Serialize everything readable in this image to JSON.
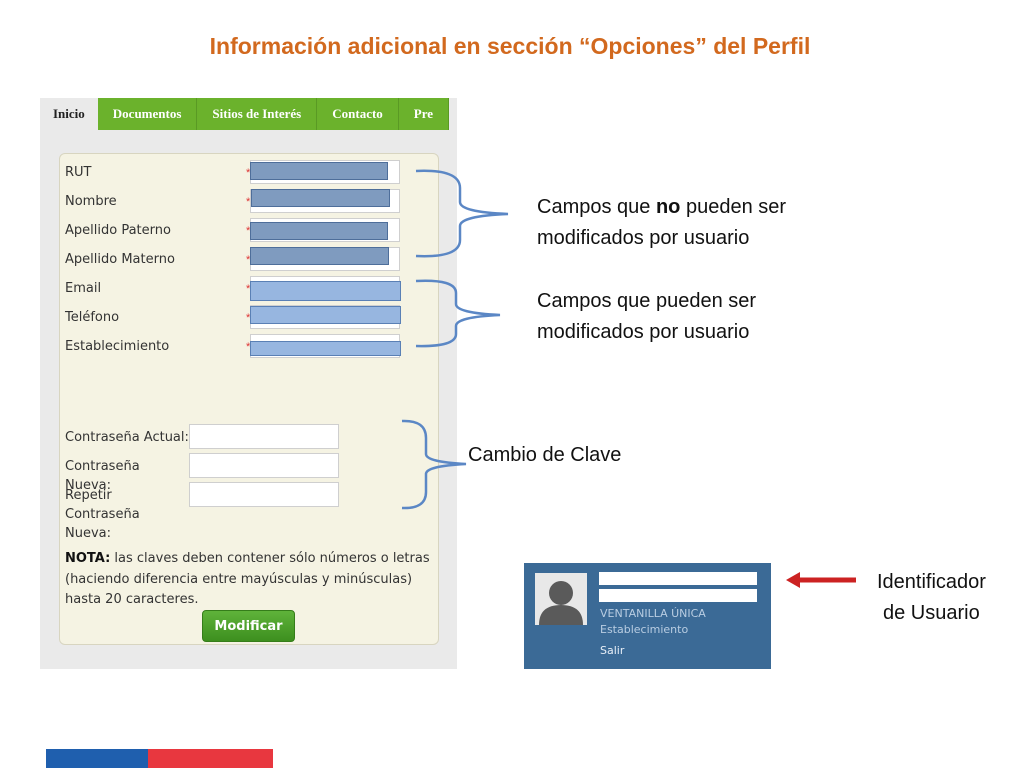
{
  "slide": {
    "title": "Información adicional en sección “Opciones” del Perfil"
  },
  "tabs": [
    "Inicio",
    "Documentos",
    "Sitios de Interés",
    "Contacto",
    "Pre"
  ],
  "profile_fields": [
    {
      "label": "RUT",
      "editable": false
    },
    {
      "label": "Nombre",
      "editable": false
    },
    {
      "label": "Apellido Paterno",
      "editable": false
    },
    {
      "label": "Apellido Materno",
      "editable": false
    },
    {
      "label": "Email",
      "editable": true
    },
    {
      "label": "Teléfono",
      "editable": true
    },
    {
      "label": "Establecimiento",
      "editable": true
    }
  ],
  "password": {
    "current_label": "Contraseña Actual:",
    "new_label": "Contraseña Nueva:",
    "repeat_label": "Repetir Contraseña Nueva:"
  },
  "note": {
    "prefix": "NOTA:",
    "text": " las claves deben contener sólo números o letras (haciendo diferencia entre mayúsculas y minúsculas) hasta 20 caracteres."
  },
  "submit_label": "Modificar",
  "annotations": {
    "non_editable_pre": "Campos que ",
    "non_editable_bold": "no",
    "non_editable_post": " pueden ser",
    "non_editable_line2": "modificados por usuario",
    "editable_line1": "Campos que pueden ser",
    "editable_line2": "modificados por usuario",
    "password_change": "Cambio de Clave",
    "user_id_line1": "Identificador",
    "user_id_line2": "de Usuario"
  },
  "user_widget": {
    "role": "VENTANILLA ÚNICA",
    "establishment": "Establecimiento",
    "logout": "Salir"
  },
  "colors": {
    "title": "#d2691e",
    "tab_green": "#6bb22c",
    "brace_blue": "#5b87c5",
    "arrow_red": "#cc2222",
    "user_box": "#3b6a96"
  }
}
